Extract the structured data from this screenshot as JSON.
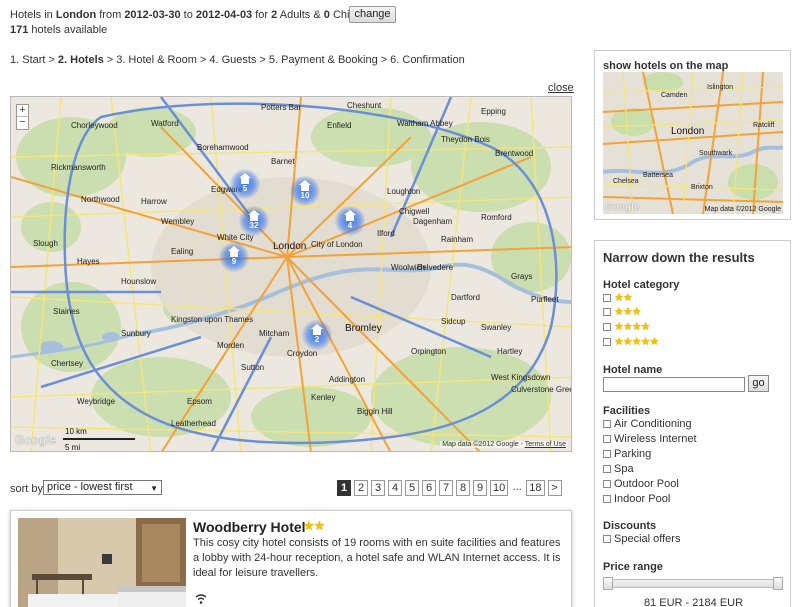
{
  "header": {
    "prefix": "Hotels in",
    "city": "London",
    "from_label": "from",
    "date_from": "2012-03-30",
    "to_label": "to",
    "date_to": "2012-04-03",
    "for_label": "for",
    "adults_count": "2",
    "adults_label": "Adults &",
    "child_count": "0",
    "child_label": "Child",
    "change_button": "change",
    "hotels_count": "171",
    "hotels_label": "hotels available"
  },
  "breadcrumb": {
    "separator": ">",
    "steps": [
      "1. Start",
      "2. Hotels",
      "3. Hotel & Room",
      "4. Guests",
      "5. Payment & Booking",
      "6. Confirmation"
    ],
    "current_index": 1
  },
  "map": {
    "close_label": "close",
    "zoom_in": "+",
    "zoom_out": "−",
    "labels": [
      {
        "text": "Watford"
      },
      {
        "text": "Enfield"
      },
      {
        "text": "Borehamwood"
      },
      {
        "text": "Chorleywood"
      },
      {
        "text": "Cheshunt"
      },
      {
        "text": "Waltham Abbey"
      },
      {
        "text": "Epping"
      },
      {
        "text": "Theydon Bois"
      },
      {
        "text": "Brentwood"
      },
      {
        "text": "Rickmansworth"
      },
      {
        "text": "Barnet"
      },
      {
        "text": "Loughton"
      },
      {
        "text": "Chigwell"
      },
      {
        "text": "Romford"
      },
      {
        "text": "Dagenham"
      },
      {
        "text": "Ilford"
      },
      {
        "text": "Slough"
      },
      {
        "text": "Hounslow"
      },
      {
        "text": "London",
        "big": true
      },
      {
        "text": "City of London"
      },
      {
        "text": "Rainham"
      },
      {
        "text": "Grays"
      },
      {
        "text": "Belvedere"
      },
      {
        "text": "Dartford"
      },
      {
        "text": "Staines"
      },
      {
        "text": "Kingston upon Thames"
      },
      {
        "text": "Sunbury"
      },
      {
        "text": "Bromley"
      },
      {
        "text": "Mitcham"
      },
      {
        "text": "Morden"
      },
      {
        "text": "Croydon"
      },
      {
        "text": "Sutton"
      },
      {
        "text": "Chertsey"
      },
      {
        "text": "Addington"
      },
      {
        "text": "Orpington"
      },
      {
        "text": "Swanley"
      },
      {
        "text": "Weybridge"
      },
      {
        "text": "Epsom"
      },
      {
        "text": "Leatherhead"
      },
      {
        "text": "Biggin Hill"
      },
      {
        "text": "West Kingsdown"
      },
      {
        "text": "Hartley"
      },
      {
        "text": "Culverstone Green"
      },
      {
        "text": "Northwood"
      },
      {
        "text": "Potters Bar"
      },
      {
        "text": "Harrow"
      },
      {
        "text": "Wembley"
      },
      {
        "text": "Hayes"
      },
      {
        "text": "Ealing"
      },
      {
        "text": "Sidcup"
      },
      {
        "text": "Woolwich"
      },
      {
        "text": "Purfleet"
      },
      {
        "text": "White City"
      },
      {
        "text": "Edgware"
      },
      {
        "text": "Kenley"
      }
    ],
    "clusters": [
      {
        "count": "5"
      },
      {
        "count": "10"
      },
      {
        "count": "32"
      },
      {
        "count": "4"
      },
      {
        "count": "9"
      },
      {
        "count": "2"
      }
    ],
    "scale_km": "10 km",
    "scale_mi": "5 mi",
    "google_logo": "Google",
    "attribution": "Map data ©2012 Google",
    "terms": "Terms of Use"
  },
  "sort": {
    "label": "sort by",
    "selected": "price - lowest first"
  },
  "pagination": {
    "pages": [
      "1",
      "2",
      "3",
      "4",
      "5",
      "6",
      "7",
      "8",
      "9",
      "10"
    ],
    "ellipsis": "...",
    "last": "18",
    "next": ">",
    "active": "1"
  },
  "hotel": {
    "name": "Woodberry Hotel",
    "stars": "★★",
    "description": "This cosy city hotel consists of 19 rooms with en suite facilities and features a lobby with 24-hour reception, a hotel safe and WLAN Internet access. It is ideal for leisure travellers."
  },
  "minimap": {
    "title": "show hotels on the map",
    "labels": [
      "London",
      "Southwark",
      "Camden",
      "Islington",
      "Ratcliff",
      "Chelsea",
      "Brixton",
      "Battersea"
    ],
    "google_logo": "Google",
    "attribution": "Map data ©2012 Google"
  },
  "filters": {
    "title": "Narrow down the results",
    "category_title": "Hotel category",
    "categories": [
      "★★",
      "★★★",
      "★★★★",
      "★★★★★"
    ],
    "name_title": "Hotel name",
    "name_value": "",
    "go_button": "go",
    "facilities_title": "Facilities",
    "facilities": [
      "Air Conditioning",
      "Wireless Internet",
      "Parking",
      "Spa",
      "Outdoor Pool",
      "Indoor Pool"
    ],
    "discounts_title": "Discounts",
    "discounts": [
      "Special offers"
    ],
    "price_title": "Price range",
    "price_min": "81",
    "price_max": "2184",
    "price_currency": "EUR",
    "price_separator": "-"
  },
  "colors": {
    "cluster_blue": "#2a6ef0",
    "motorway": "#6b8fd6",
    "primary_road": "#f3a23a",
    "secondary_road": "#f4e57b",
    "green": "#c8deab",
    "water": "#a5bfdd",
    "star": "#f2c200"
  }
}
